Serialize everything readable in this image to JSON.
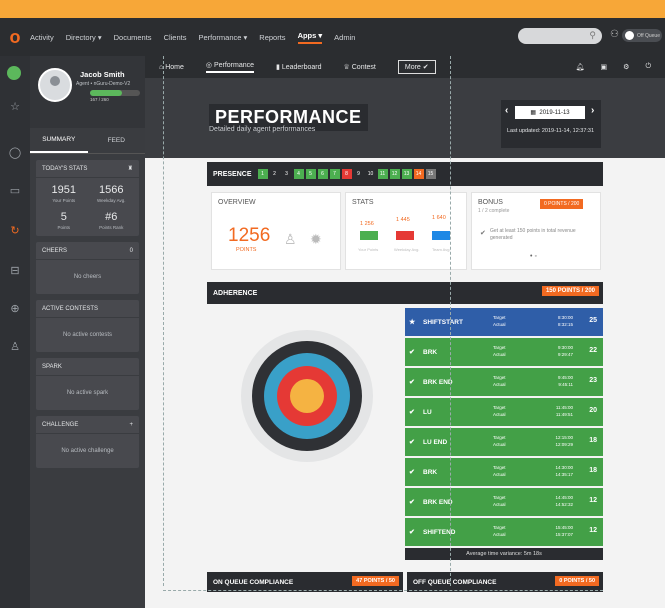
{
  "topbar": {
    "logo": "o",
    "nav": [
      "Activity",
      "Directory ▾",
      "Documents",
      "Clients",
      "Performance ▾",
      "Reports",
      "Apps ▾",
      "Admin"
    ],
    "active_nav": "Apps ▾",
    "toggle_label": "Off Queue"
  },
  "profile": {
    "name": "Jacob Smith",
    "role": "Agent • nGuru-Demo-V2",
    "progress_text": "167 / 260",
    "progress_fraction": 0.64
  },
  "sidebar": {
    "tabs": [
      "SUMMARY",
      "FEED"
    ],
    "todays_stats_title": "TODAY'S STATS",
    "stats": [
      {
        "value": "1951",
        "label": "Your Points"
      },
      {
        "value": "1566",
        "label": "Weekday Avg."
      },
      {
        "value": "5",
        "label": "Points"
      },
      {
        "value": "#6",
        "label": "Points Rank"
      }
    ],
    "cards": [
      {
        "title": "CHEERS",
        "badge": "0",
        "empty": "No cheers"
      },
      {
        "title": "ACTIVE CONTESTS",
        "badge": "",
        "empty": "No active contests"
      },
      {
        "title": "SPARK",
        "badge": "",
        "empty": "No active spark"
      },
      {
        "title": "CHALLENGE",
        "badge": "+",
        "empty": "No active challenge"
      }
    ]
  },
  "subnav": {
    "home": "Home",
    "performance": "Performance",
    "leaderboard": "Leaderboard",
    "contest": "Contest",
    "more": "More ✔"
  },
  "header": {
    "title": "PERFORMANCE",
    "subtitle": "Detailed daily agent performances",
    "date": "2019-11-13",
    "last_updated": "Last updated: 2019-11-14, 12:37:31"
  },
  "presence": {
    "label": "PRESENCE",
    "cells": [
      {
        "n": "1",
        "c": "#4caf50"
      },
      {
        "n": "2",
        "c": "#2a2c30"
      },
      {
        "n": "3",
        "c": "#2a2c30"
      },
      {
        "n": "4",
        "c": "#4caf50"
      },
      {
        "n": "5",
        "c": "#4caf50"
      },
      {
        "n": "6",
        "c": "#4caf50"
      },
      {
        "n": "7",
        "c": "#4caf50"
      },
      {
        "n": "8",
        "c": "#e53935"
      },
      {
        "n": "9",
        "c": "#2a2c30"
      },
      {
        "n": "10",
        "c": "#2a2c30"
      },
      {
        "n": "11",
        "c": "#4caf50"
      },
      {
        "n": "12",
        "c": "#4caf50"
      },
      {
        "n": "13",
        "c": "#4caf50"
      },
      {
        "n": "14",
        "c": "#f26a21"
      },
      {
        "n": "15",
        "c": "#777"
      }
    ]
  },
  "overview": {
    "title": "OVERVIEW",
    "points": "1256",
    "points_label": "POINTS"
  },
  "stats_panel": {
    "title": "STATS",
    "values": [
      "1 256",
      "1 445",
      "1 640"
    ],
    "labels": [
      "Your Points",
      "Weekday Avg.",
      "Team Avg."
    ]
  },
  "bonus": {
    "title": "BONUS",
    "sub": "1 / 2 complete",
    "badge": "0 POINTS / 200",
    "item": "Get at least 150 points in total revenue generated"
  },
  "adherence": {
    "title": "ADHERENCE",
    "badge": "150 POINTS / 200",
    "rows": [
      {
        "name": "SHIFTSTART",
        "target": "8:30:00",
        "actual": "8:32:15",
        "score": "25",
        "c": "#2f5ea8",
        "icon": "★"
      },
      {
        "name": "BRK",
        "target": "9:30:00",
        "actual": "9:29:47",
        "score": "22",
        "c": "#43a047",
        "icon": "✔"
      },
      {
        "name": "BRK END",
        "target": "9:45:00",
        "actual": "9:45:11",
        "score": "23",
        "c": "#43a047",
        "icon": "✔"
      },
      {
        "name": "LU",
        "target": "11:45:00",
        "actual": "11:49:51",
        "score": "20",
        "c": "#43a047",
        "icon": "✔"
      },
      {
        "name": "LU END",
        "target": "12:15:00",
        "actual": "12:09:29",
        "score": "18",
        "c": "#43a047",
        "icon": "✔"
      },
      {
        "name": "BRK",
        "target": "14:30:00",
        "actual": "14:35:17",
        "score": "18",
        "c": "#43a047",
        "icon": "✔"
      },
      {
        "name": "BRK END",
        "target": "14:45:00",
        "actual": "14:52:32",
        "score": "12",
        "c": "#43a047",
        "icon": "✔"
      },
      {
        "name": "SHIFTEND",
        "target": "15:45:00",
        "actual": "15:37:07",
        "score": "12",
        "c": "#43a047",
        "icon": "✔"
      }
    ],
    "target_word": "Target",
    "actual_word": "Actual",
    "variance": "Average time variance: 5m 18s"
  },
  "compliance": {
    "on_title": "ON QUEUE COMPLIANCE",
    "on_badge": "47 POINTS / 50",
    "off_title": "OFF QUEUE COMPLIANCE",
    "off_badge": "0 POINTS / 50"
  }
}
